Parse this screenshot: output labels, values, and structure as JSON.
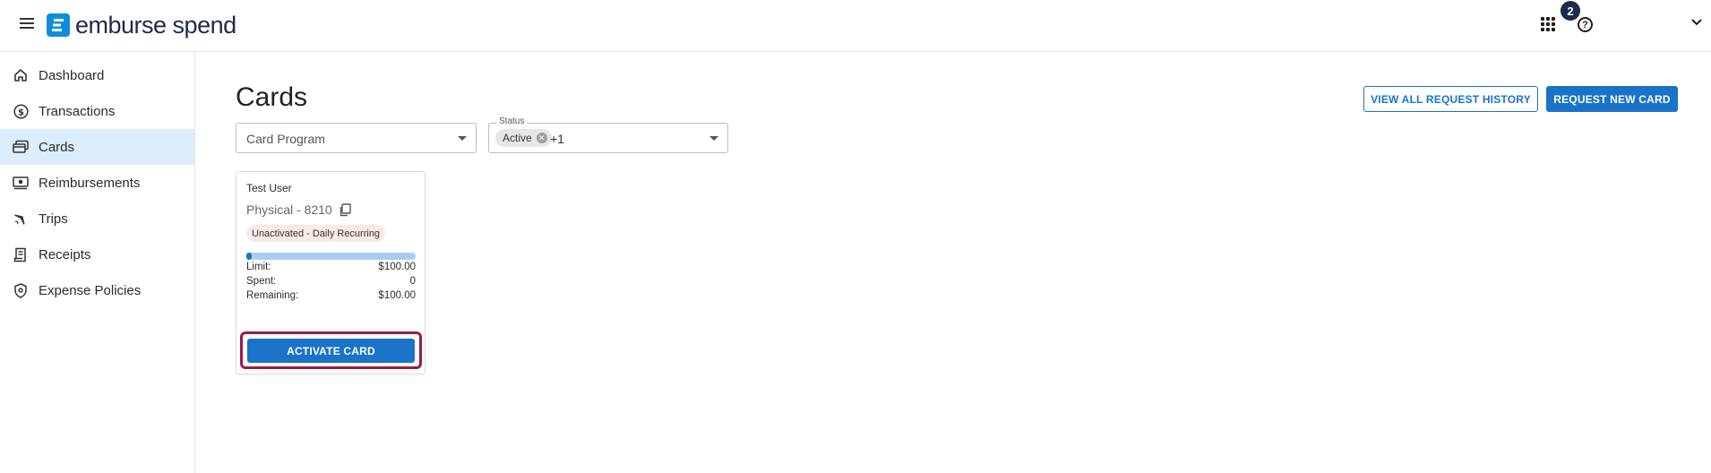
{
  "header": {
    "logo_text": "emburse spend",
    "notification_count": "2",
    "help_glyph": "?"
  },
  "sidebar": {
    "items": [
      {
        "label": "Dashboard",
        "icon": "home-icon",
        "active": false
      },
      {
        "label": "Transactions",
        "icon": "dollar-circle-icon",
        "active": false
      },
      {
        "label": "Cards",
        "icon": "cards-icon",
        "active": true
      },
      {
        "label": "Reimbursements",
        "icon": "cash-icon",
        "active": false
      },
      {
        "label": "Trips",
        "icon": "airplane-icon",
        "active": false
      },
      {
        "label": "Receipts",
        "icon": "receipt-icon",
        "active": false
      },
      {
        "label": "Expense Policies",
        "icon": "shield-icon",
        "active": false
      }
    ]
  },
  "main": {
    "title": "Cards",
    "view_history_label": "VIEW ALL REQUEST HISTORY",
    "request_card_label": "REQUEST NEW CARD",
    "filters": {
      "card_program_placeholder": "Card Program",
      "status_label": "Status",
      "status_chip": "Active",
      "status_more": "+1"
    },
    "card": {
      "user": "Test User",
      "type": "Physical - 8210",
      "status": "Unactivated - Daily Recurring",
      "spent_fraction": 0,
      "limit_label": "Limit:",
      "limit_value": "$100.00",
      "spent_label": "Spent:",
      "spent_value": "0",
      "remaining_label": "Remaining:",
      "remaining_value": "$100.00",
      "activate_label": "ACTIVATE CARD"
    }
  },
  "colors": {
    "brand": "#0a8fd8",
    "primary": "#1a73c9",
    "active_nav_bg": "#dceefb",
    "highlight_border": "#a0184a",
    "status_pill_bg": "#fbe9e7"
  }
}
